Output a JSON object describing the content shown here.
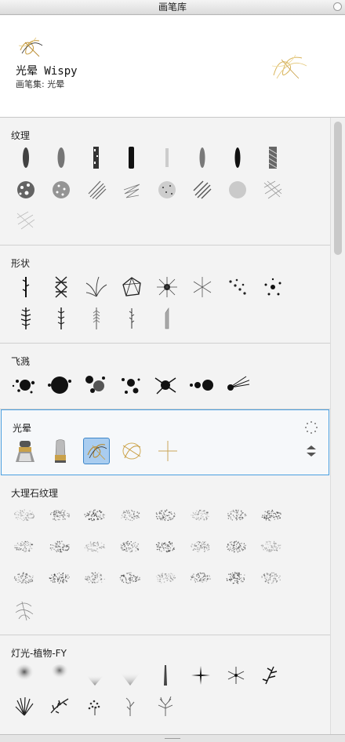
{
  "window": {
    "title": "画笔库"
  },
  "preview": {
    "brush_name": "光晕 Wispy",
    "brush_set": "画笔集: 光晕"
  },
  "sections": [
    {
      "title": "纹理",
      "brushes": [
        "soft-pencil-brush",
        "soft-graphite-brush",
        "rough-chalk-brush",
        "hard-marker-brush",
        "faint-pencil-brush",
        "soft-charcoal-brush",
        "ink-marker-brush",
        "crosshatch-brush",
        "splatter-texture-brush",
        "grain-texture-brush",
        "hatch-lines-brush",
        "scribble-brush",
        "speckle-brush",
        "diagonal-hatch-brush",
        "noise-brush",
        "crosshatch-grid-brush",
        "light-crosshatch-brush"
      ]
    },
    {
      "title": "形状",
      "brushes": [
        "vine-brush",
        "lattice-brush",
        "grass-blades-brush",
        "polygon-web-brush",
        "starburst-brush",
        "spark-brush",
        "dots-brush",
        "scatter-dots-brush",
        "pine-branch-brush",
        "fern-leaf-brush",
        "feather-brush",
        "twig-brush",
        "pen-nib-brush"
      ]
    },
    {
      "title": "飞溅",
      "brushes": [
        "ink-splat-brush",
        "blob-splat-brush",
        "drip-splat-brush",
        "spray-splat-brush",
        "burst-splat-brush",
        "circles-brush",
        "streak-splat-brush"
      ]
    },
    {
      "title": "光晕",
      "brushes": [
        "golden-marker-brush",
        "golden-pen-brush",
        "wispy-brush",
        "swirl-brush",
        "sparkle-cross-brush"
      ]
    },
    {
      "title": "大理石纹理",
      "brushes": [
        "marble-01",
        "marble-02",
        "marble-03",
        "marble-04",
        "marble-05",
        "marble-06",
        "marble-07",
        "marble-08",
        "marble-09",
        "marble-10",
        "marble-11",
        "marble-12",
        "marble-13",
        "marble-14",
        "marble-15",
        "marble-16",
        "marble-17",
        "marble-18",
        "marble-19",
        "marble-20",
        "marble-21",
        "marble-22",
        "marble-23",
        "marble-24",
        "marble-vein-brush"
      ]
    },
    {
      "title": "灯光-植物-FY",
      "brushes": [
        "spotlight-brush",
        "soft-light-brush",
        "cone-light-brush",
        "wide-cone-light-brush",
        "light-beam-brush",
        "star-glint-brush",
        "flare-brush",
        "leaf-sprig-brush",
        "grass-clump-brush",
        "foliage-brush",
        "bush-brush",
        "twig-plant-brush",
        "tree-branch-brush"
      ]
    }
  ],
  "icons": {
    "settings": "loading-dots-icon",
    "reorder": "up-down-arrows-icon"
  },
  "colors": {
    "selection": "#a9cdf0",
    "selected_border": "#4a9fe0",
    "glow_gold": "#d8b45a"
  }
}
